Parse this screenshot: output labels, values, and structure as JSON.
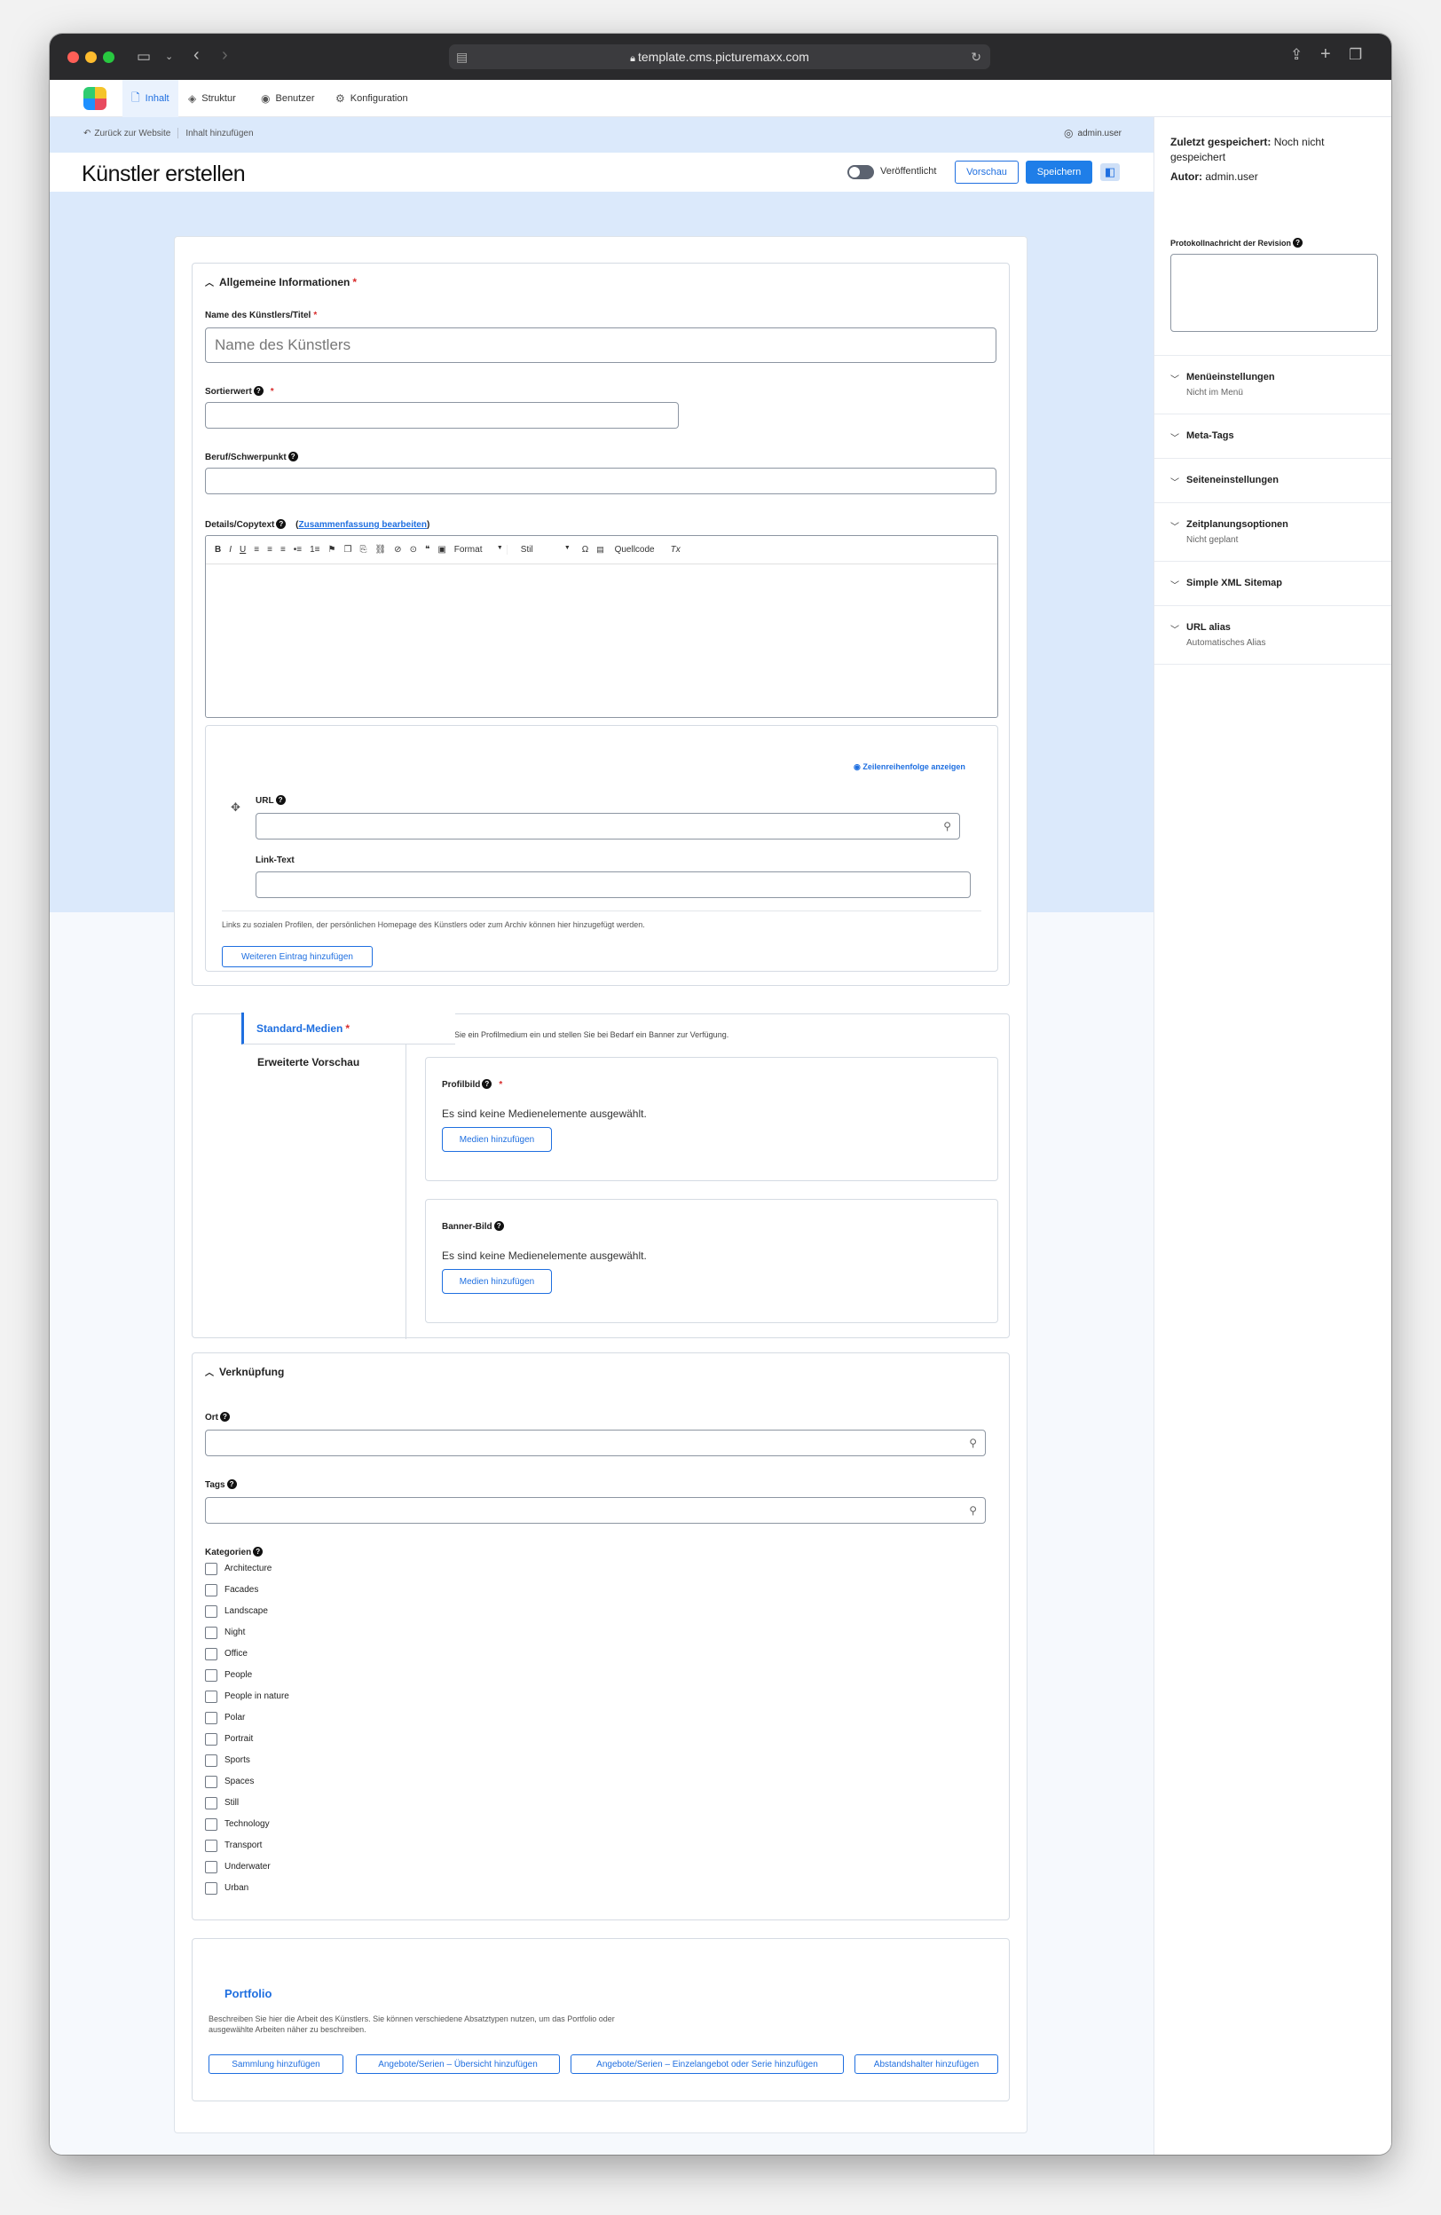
{
  "browser": {
    "url": "template.cms.picturemaxx.com"
  },
  "nav": {
    "items": [
      {
        "label": "Inhalt"
      },
      {
        "label": "Struktur"
      },
      {
        "label": "Benutzer"
      },
      {
        "label": "Konfiguration"
      }
    ]
  },
  "breadcrumb": {
    "back": "Zurück zur Website",
    "current": "Inhalt hinzufügen"
  },
  "user": {
    "name": "admin.user"
  },
  "header": {
    "title": "Künstler erstellen",
    "published_label": "Veröffentlicht",
    "preview_label": "Vorschau",
    "save_label": "Speichern"
  },
  "general": {
    "title": "Allgemeine Informationen",
    "name_label": "Name des Künstlers/Titel",
    "name_placeholder": "Name des Künstlers",
    "sort_label": "Sortierwert",
    "job_label": "Beruf/Schwerpunkt",
    "details_label": "Details/Copytext",
    "summary_link": "Zusammenfassung bearbeiten",
    "toolbar": [
      "B",
      "I",
      "U",
      "≡",
      "≡",
      "≡",
      "•≡",
      "1≡",
      "⚑",
      "❐",
      "⎘",
      "⛓",
      "⊘",
      "⊙",
      "❝",
      "▣",
      "Format",
      "Stil",
      "Ω",
      "Quellcode",
      "Tx"
    ],
    "row_order_link": "Zeilenreihenfolge anzeigen",
    "url_label": "URL",
    "linktext_label": "Link-Text",
    "links_help": "Links zu sozialen Profilen, der persönlichen Homepage des Künstlers oder zum Archiv können hier hinzugefügt werden.",
    "add_entry_button": "Weiteren Eintrag hinzufügen"
  },
  "media": {
    "tab_standard": "Standard-Medien",
    "tab_extended": "Erweiterte Vorschau",
    "description": "Richten Sie ein Profilmedium ein und stellen Sie bei Bedarf ein Banner zur Verfügung.",
    "profile_label": "Profilbild",
    "banner_label": "Banner-Bild",
    "empty_text": "Es sind keine Medienelemente ausgewählt.",
    "add_button": "Medien hinzufügen"
  },
  "link_section": {
    "title": "Verknüpfung",
    "location_label": "Ort",
    "tags_label": "Tags",
    "categories_label": "Kategorien",
    "categories": [
      "Architecture",
      "Facades",
      "Landscape",
      "Night",
      "Office",
      "People",
      "People in nature",
      "Polar",
      "Portrait",
      "Sports",
      "Spaces",
      "Still",
      "Technology",
      "Transport",
      "Underwater",
      "Urban"
    ]
  },
  "portfolio": {
    "title": "Portfolio",
    "description": "Beschreiben Sie hier die Arbeit des Künstlers. Sie können verschiedene Absatztypen nutzen, um das Portfolio oder ausgewählte Arbeiten näher zu beschreiben.",
    "buttons": [
      "Sammlung hinzufügen",
      "Angebote/Serien – Übersicht hinzufügen",
      "Angebote/Serien – Einzelangebot oder Serie hinzufügen",
      "Abstandshalter hinzufügen"
    ]
  },
  "sidebar": {
    "last_saved_label": "Zuletzt gespeichert:",
    "last_saved_value": "Noch nicht gespeichert",
    "author_label": "Autor:",
    "author_value": "admin.user",
    "revision_label": "Protokollnachricht der Revision",
    "items": [
      {
        "title": "Menüeinstellungen",
        "sub": "Nicht im Menü"
      },
      {
        "title": "Meta-Tags",
        "sub": ""
      },
      {
        "title": "Seiteneinstellungen",
        "sub": ""
      },
      {
        "title": "Zeitplanungsoptionen",
        "sub": "Nicht geplant"
      },
      {
        "title": "Simple XML Sitemap",
        "sub": ""
      },
      {
        "title": "URL alias",
        "sub": "Automatisches Alias"
      }
    ]
  },
  "colors": {
    "accent": "#1f6fe0",
    "required": "#d82b2b"
  }
}
